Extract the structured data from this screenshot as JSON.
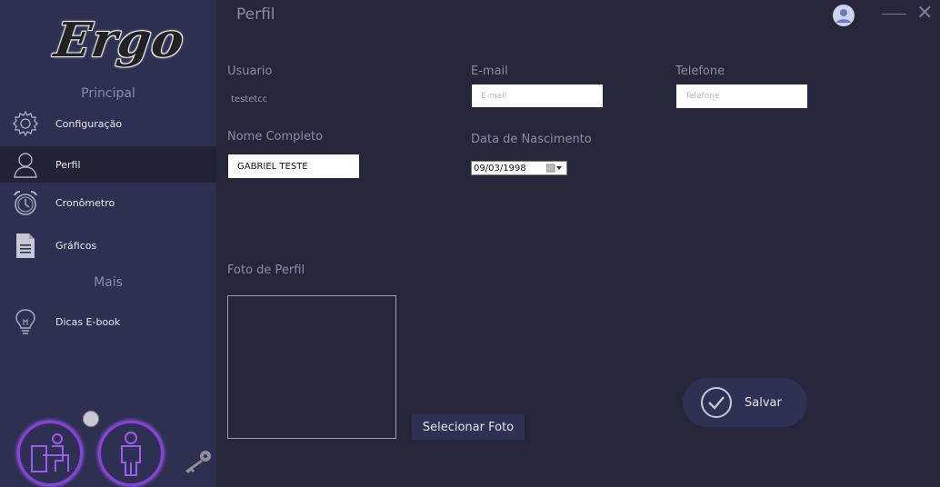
{
  "window": {
    "page_title": "Perfil"
  },
  "sidebar": {
    "logo_text": "Ergo",
    "section_main": "Principal",
    "section_more": "Mais",
    "items": [
      {
        "label": "Configuração",
        "icon": "gear-icon"
      },
      {
        "label": "Perfil",
        "icon": "person-icon"
      },
      {
        "label": "Cronômetro",
        "icon": "alarm-clock-icon"
      },
      {
        "label": "Gráficos",
        "icon": "document-icon"
      },
      {
        "label": "Dicas E-book",
        "icon": "lightbulb-icon"
      }
    ]
  },
  "form": {
    "usuario_label": "Usuario",
    "usuario_value": "testetcc",
    "email_label": "E-mail",
    "email_placeholder": "E-mail",
    "telefone_label": "Telefone",
    "telefone_placeholder": "Telefone",
    "nome_label": "Nome Completo",
    "nome_value": "GABRIEL TESTE",
    "nascimento_label": "Data de Nascimento",
    "nascimento_value": "09/03/1998",
    "foto_label": "Foto de Perfil",
    "select_photo_label": "Selecionar Foto",
    "save_label": "Salvar"
  },
  "colors": {
    "background": "#26263a",
    "sidebar": "#2d3050",
    "accent_purple": "#8a3fe0"
  }
}
